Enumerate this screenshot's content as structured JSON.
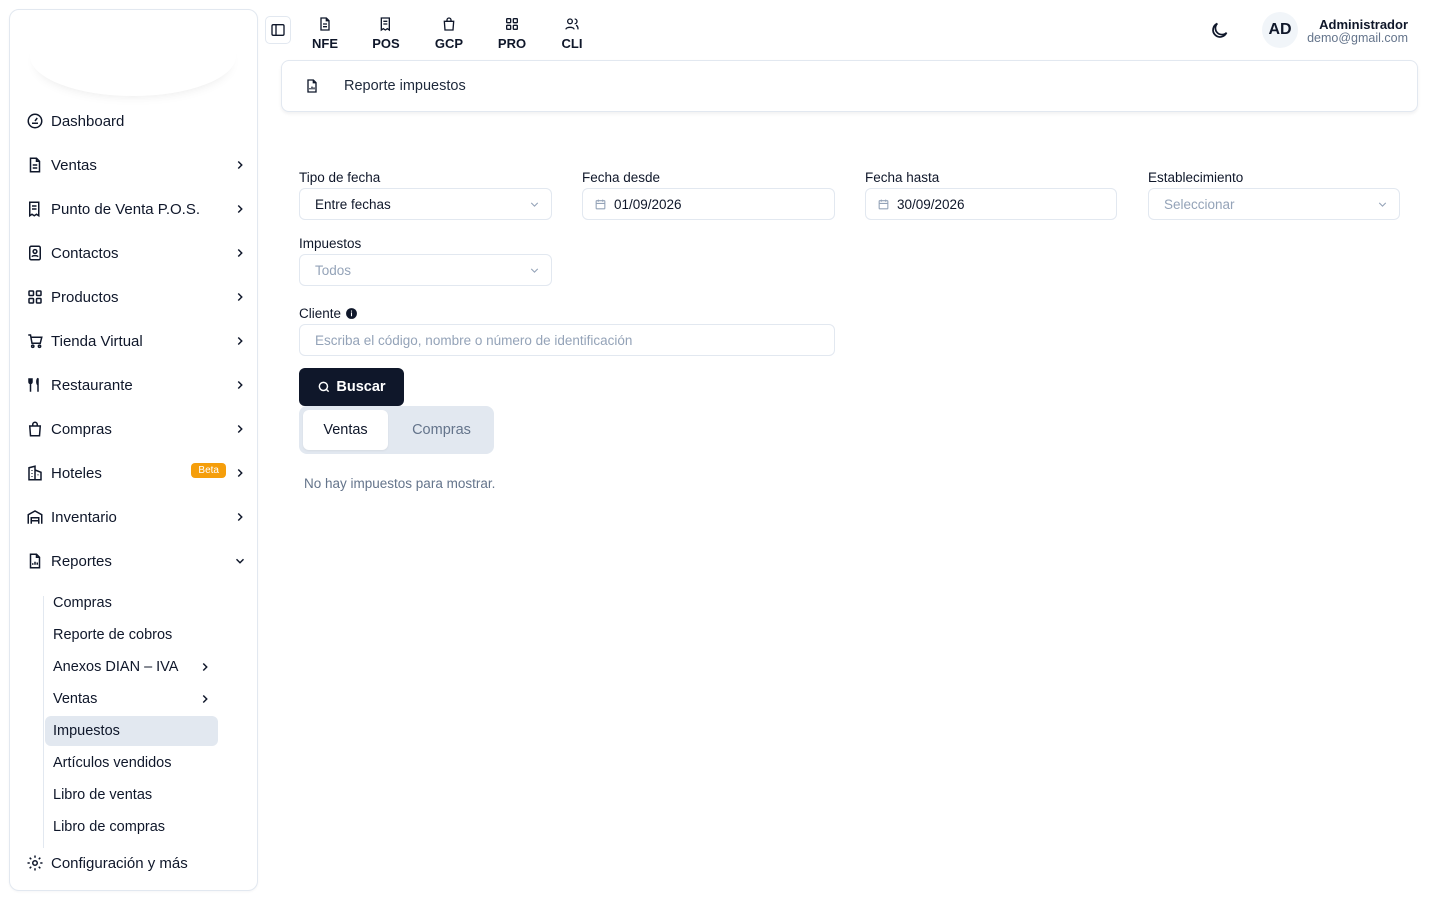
{
  "topbar": {
    "modules": [
      {
        "label": "NFE",
        "icon": "document-icon"
      },
      {
        "label": "POS",
        "icon": "receipt-icon"
      },
      {
        "label": "GCP",
        "icon": "bag-icon"
      },
      {
        "label": "PRO",
        "icon": "grid-icon"
      },
      {
        "label": "CLI",
        "icon": "users-icon"
      }
    ],
    "user": {
      "initials": "AD",
      "name": "Administrador",
      "email": "demo@gmail.com"
    }
  },
  "sidebar": {
    "items": [
      {
        "label": "Dashboard",
        "icon": "gauge-icon"
      },
      {
        "label": "Ventas",
        "icon": "file-text-icon"
      },
      {
        "label": "Punto de Venta P.O.S.",
        "icon": "receipt-icon"
      },
      {
        "label": "Contactos",
        "icon": "contact-book-icon"
      },
      {
        "label": "Productos",
        "icon": "grid-icon"
      },
      {
        "label": "Tienda Virtual",
        "icon": "cart-icon"
      },
      {
        "label": "Restaurante",
        "icon": "utensils-icon"
      },
      {
        "label": "Compras",
        "icon": "bag-icon"
      },
      {
        "label": "Hoteles",
        "icon": "building-icon",
        "badge": "Beta"
      },
      {
        "label": "Inventario",
        "icon": "warehouse-icon"
      },
      {
        "label": "Reportes",
        "icon": "report-icon"
      }
    ],
    "reportes_sub": [
      {
        "label": "Compras"
      },
      {
        "label": "Reporte de cobros"
      },
      {
        "label": "Anexos DIAN – IVA"
      },
      {
        "label": "Ventas"
      },
      {
        "label": "Impuestos"
      },
      {
        "label": "Artículos vendidos"
      },
      {
        "label": "Libro de ventas"
      },
      {
        "label": "Libro de compras"
      }
    ],
    "settings_label": "Configuración y más"
  },
  "page": {
    "title": "Reporte impuestos"
  },
  "form": {
    "tipo_fecha": {
      "label": "Tipo de fecha",
      "value": "Entre fechas"
    },
    "fecha_desde": {
      "label": "Fecha desde",
      "value": "01/09/2026"
    },
    "fecha_hasta": {
      "label": "Fecha hasta",
      "value": "30/09/2026"
    },
    "establecimiento": {
      "label": "Establecimiento",
      "placeholder": "Seleccionar"
    },
    "impuestos": {
      "label": "Impuestos",
      "placeholder": "Todos"
    },
    "cliente": {
      "label": "Cliente",
      "placeholder": "Escriba el código, nombre o número de identificación"
    },
    "search_button": "Buscar"
  },
  "tabs": {
    "ventas": "Ventas",
    "compras": "Compras",
    "active": "Ventas"
  },
  "empty_message": "No hay impuestos para mostrar.",
  "colors": {
    "primary": "#0f172a",
    "beta_badge": "#f59e0b",
    "active_bg": "#e2e8f0"
  }
}
